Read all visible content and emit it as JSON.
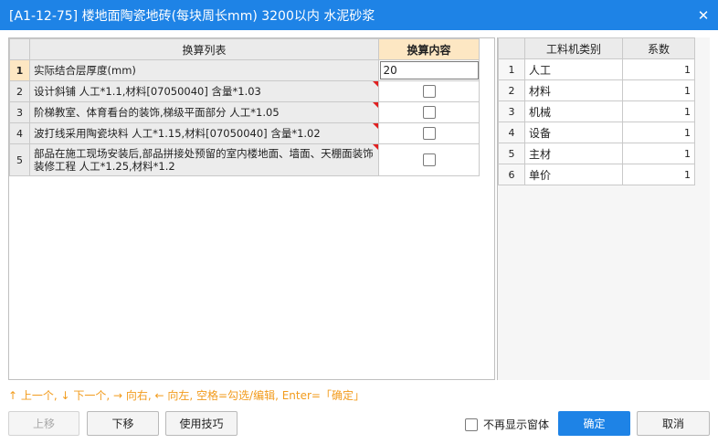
{
  "window": {
    "title": "[A1-12-75] 楼地面陶瓷地砖(每块周长mm) 3200以内 水泥砂浆",
    "close_label": "✕"
  },
  "left_grid": {
    "headers": {
      "list": "换算列表",
      "content": "换算内容"
    },
    "rows": [
      {
        "num": "1",
        "desc": "实际结合层厚度(mm)",
        "value": "20",
        "type": "input"
      },
      {
        "num": "2",
        "desc": "设计斜铺 人工*1.1,材料[07050040] 含量*1.03",
        "checked": false,
        "type": "checkbox"
      },
      {
        "num": "3",
        "desc": "阶梯教室、体育看台的装饰,梯级平面部分 人工*1.05",
        "checked": false,
        "type": "checkbox"
      },
      {
        "num": "4",
        "desc": "波打线采用陶瓷块料 人工*1.15,材料[07050040] 含量*1.02",
        "checked": false,
        "type": "checkbox"
      },
      {
        "num": "5",
        "desc": "部品在施工现场安装后,部品拼接处预留的室内楼地面、墙面、天棚面装饰装修工程 人工*1.25,材料*1.2",
        "checked": false,
        "type": "checkbox"
      }
    ]
  },
  "right_grid": {
    "headers": {
      "category": "工料机类别",
      "coef": "系数"
    },
    "rows": [
      {
        "num": "1",
        "category": "人工",
        "coef": "1"
      },
      {
        "num": "2",
        "category": "材料",
        "coef": "1"
      },
      {
        "num": "3",
        "category": "机械",
        "coef": "1"
      },
      {
        "num": "4",
        "category": "设备",
        "coef": "1"
      },
      {
        "num": "5",
        "category": "主材",
        "coef": "1"
      },
      {
        "num": "6",
        "category": "单价",
        "coef": "1"
      }
    ]
  },
  "hint": "↑ 上一个, ↓ 下一个, → 向右, ← 向左, 空格=勾选/编辑, Enter=「确定」",
  "buttons": {
    "up": "上移",
    "down": "下移",
    "tips": "使用技巧",
    "no_show": "不再显示窗体",
    "ok": "确定",
    "cancel": "取消"
  },
  "colors": {
    "accent": "#1e83e6",
    "hint": "#f29b1c",
    "highlight": "#fde7c3",
    "mark": "#e02020"
  }
}
